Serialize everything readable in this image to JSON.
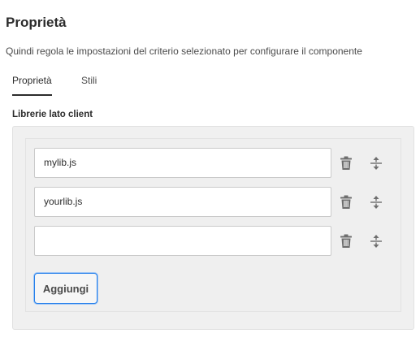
{
  "page": {
    "title": "Proprietà",
    "description": "Quindi regola le impostazioni del criterio selezionato per configurare il componente"
  },
  "tabs": [
    {
      "label": "Proprietà",
      "selected": true
    },
    {
      "label": "Stili",
      "selected": false
    }
  ],
  "section": {
    "label": "Librerie lato client"
  },
  "libraries": [
    {
      "value": "mylib.js"
    },
    {
      "value": "yourlib.js"
    },
    {
      "value": ""
    }
  ],
  "actions": {
    "add_label": "Aggiungi",
    "row_icons": [
      "trash-icon",
      "reorder-icon"
    ]
  },
  "colors": {
    "accent": "#2680eb",
    "panel": "#f0f0f0",
    "icon": "#6e6e6e"
  }
}
